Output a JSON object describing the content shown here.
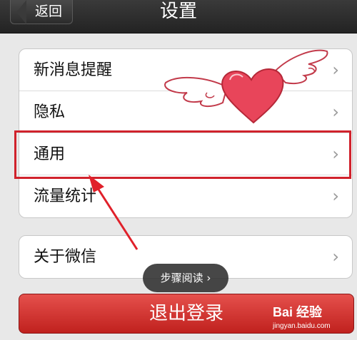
{
  "navbar": {
    "back_label": "返回",
    "title": "设置"
  },
  "settings_groups": [
    {
      "items": [
        {
          "label": "新消息提醒"
        },
        {
          "label": "隐私"
        },
        {
          "label": "通用"
        },
        {
          "label": "流量统计"
        }
      ]
    },
    {
      "items": [
        {
          "label": "关于微信"
        }
      ]
    }
  ],
  "step_reading": "步骤阅读",
  "logout_label": "退出登录",
  "watermark": {
    "brand": "Bai 经验",
    "site": "jingyan.baidu.com"
  },
  "colors": {
    "highlight": "#d0222c",
    "logout": "#c0211e",
    "heart": "#e8455a"
  }
}
